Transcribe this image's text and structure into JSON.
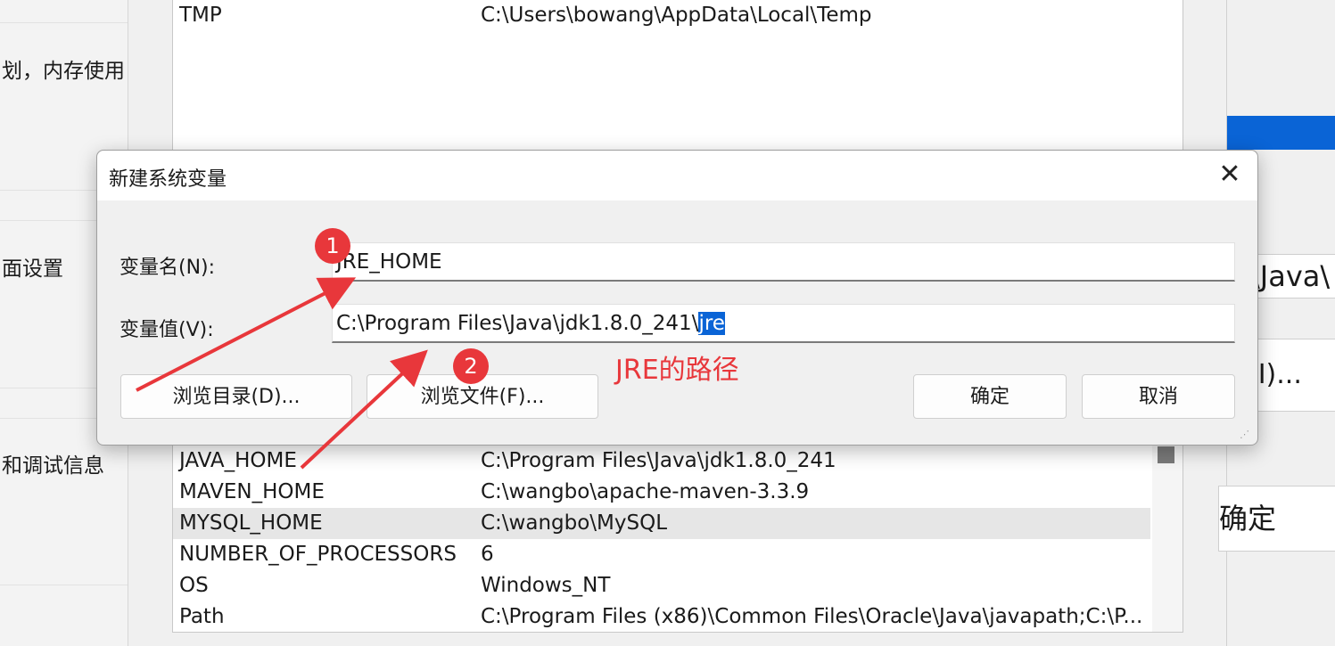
{
  "left_panel": {
    "lines": [
      "划，内存使用",
      "面设置",
      "和调试信息"
    ]
  },
  "user_vars": [
    {
      "name": "TMP",
      "value": "C:\\Users\\bowang\\AppData\\Local\\Temp"
    }
  ],
  "system_vars": [
    {
      "name": "JAVA_HOME",
      "value": "C:\\Program Files\\Java\\jdk1.8.0_241",
      "selected": false
    },
    {
      "name": "MAVEN_HOME",
      "value": "C:\\wangbo\\apache-maven-3.3.9",
      "selected": false
    },
    {
      "name": "MYSQL_HOME",
      "value": "C:\\wangbo\\MySQL",
      "selected": true
    },
    {
      "name": "NUMBER_OF_PROCESSORS",
      "value": "6",
      "selected": false
    },
    {
      "name": "OS",
      "value": "Windows_NT",
      "selected": false
    },
    {
      "name": "Path",
      "value": "C:\\Program Files (x86)\\Common Files\\Oracle\\Java\\javapath;C:\\P...",
      "selected": false
    }
  ],
  "right_window": {
    "path_fragment": "\\Java\\",
    "button_fragment": "(I)...",
    "ok_fragment": "确定"
  },
  "dialog": {
    "title": "新建系统变量",
    "close_symbol": "✕",
    "name_label": "变量名(N):",
    "name_value": "JRE_HOME",
    "value_label": "变量值(V):",
    "value_prefix": "C:\\Program Files\\Java\\jdk1.8.0_241\\",
    "value_selected": "jre",
    "browse_dir": "浏览目录(D)...",
    "browse_file": "浏览文件(F)...",
    "ok": "确定",
    "cancel": "取消"
  },
  "annotations": {
    "badge1": "1",
    "badge2": "2",
    "text": "JRE的路径",
    "color": "#e8373b"
  }
}
